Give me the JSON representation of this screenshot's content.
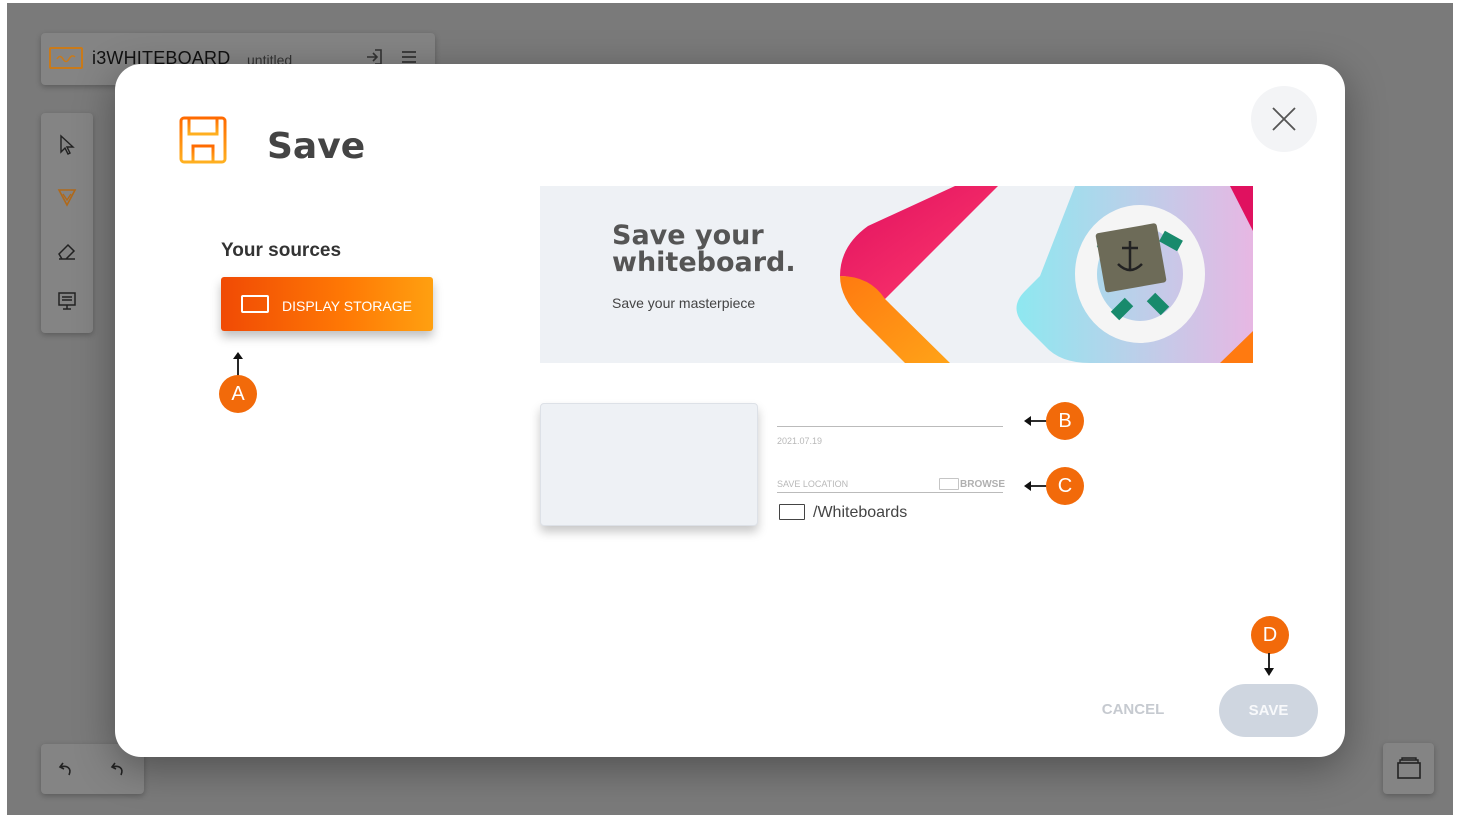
{
  "app": {
    "name": "i3WHITEBOARD",
    "document": "untitled"
  },
  "modal": {
    "title": "Save",
    "sources_heading": "Your sources",
    "source_button": "DISPLAY STORAGE",
    "banner": {
      "title": "Save your whiteboard.",
      "subtitle": "Save your masterpiece"
    },
    "form": {
      "name_value": "",
      "date": "2021.07.19",
      "save_location_label": "SAVE LOCATION",
      "browse_label": "BROWSE",
      "path": "/Whiteboards"
    },
    "cancel_label": "CANCEL",
    "save_label": "SAVE"
  },
  "callouts": {
    "a": "A",
    "b": "B",
    "c": "C",
    "d": "D"
  },
  "colors": {
    "accent": "#f26a0a",
    "backdrop": "#7a7a7a",
    "save_disabled": "#cfd6e0"
  },
  "icons": [
    "logo-icon",
    "login-icon",
    "menu-icon",
    "pointer-icon",
    "pen-icon",
    "eraser-icon",
    "present-icon",
    "undo-icon",
    "redo-icon",
    "layers-icon",
    "close-icon",
    "save-icon",
    "screen-icon",
    "folder-icon"
  ]
}
